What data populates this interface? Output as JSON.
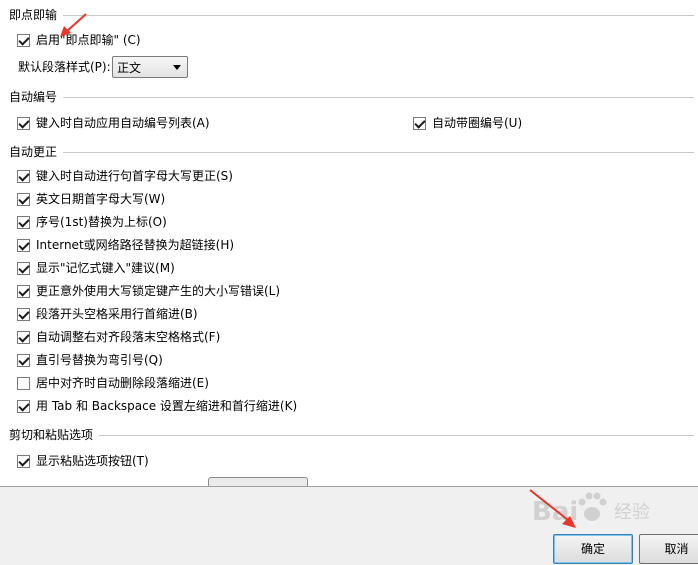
{
  "sections": {
    "instant_input": {
      "header": "即点即输",
      "enable_label": "启用\"即点即输\" (C)",
      "enable_checked": true,
      "default_style_label": "默认段落样式(P):",
      "default_style_value": "正文"
    },
    "auto_numbering": {
      "header": "自动编号",
      "items": [
        {
          "label": "键入时自动应用自动编号列表(A)",
          "checked": true
        },
        {
          "label": "自动带圈编号(U)",
          "checked": true
        }
      ]
    },
    "auto_correct": {
      "header": "自动更正",
      "items": [
        {
          "label": "键入时自动进行句首字母大写更正(S)",
          "checked": true
        },
        {
          "label": "英文日期首字母大写(W)",
          "checked": true
        },
        {
          "label": "序号(1st)替换为上标(O)",
          "checked": true
        },
        {
          "label": "Internet或网络路径替换为超链接(H)",
          "checked": true
        },
        {
          "label": "显示\"记忆式键入\"建议(M)",
          "checked": true
        },
        {
          "label": "更正意外使用大写锁定键产生的大小写错误(L)",
          "checked": true
        },
        {
          "label": "段落开头空格采用行首缩进(B)",
          "checked": true
        },
        {
          "label": "自动调整右对齐段落末空格格式(F)",
          "checked": true
        },
        {
          "label": "直引号替换为弯引号(Q)",
          "checked": true
        },
        {
          "label": "居中对齐时自动删除段落缩进(E)",
          "checked": false
        },
        {
          "label": "用 Tab 和 Backspace 设置左缩进和首行缩进(K)",
          "checked": true
        }
      ]
    },
    "cut_paste": {
      "header": "剪切和粘贴选项",
      "items": [
        {
          "label": "显示粘贴选项按钮(T)",
          "checked": true
        }
      ]
    }
  },
  "footer": {
    "ok_label": "确定",
    "cancel_label": "取消"
  },
  "watermark": {
    "brand": "Bai",
    "suffix": "经验"
  },
  "colors": {
    "annotation_arrow": "#e8362a",
    "checkbox_mark": "#1c1c1c",
    "default_button_border": "#3c7fb1"
  }
}
